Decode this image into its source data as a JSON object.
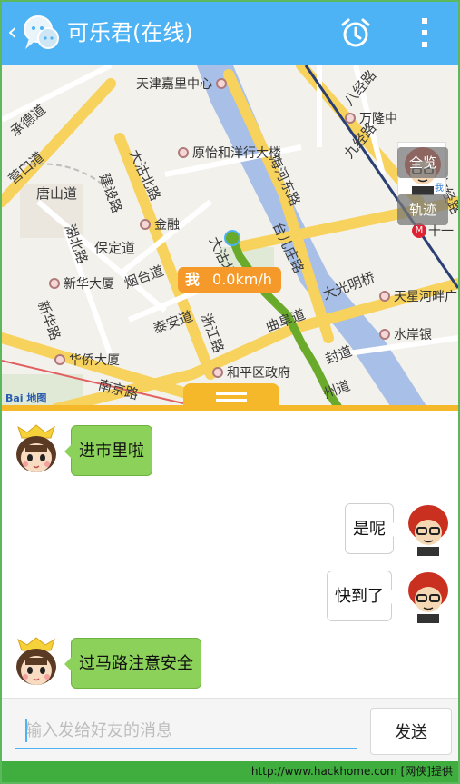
{
  "header": {
    "title": "可乐君(在线)",
    "back_glyph": "‹"
  },
  "map": {
    "speed_tag": {
      "me": "我",
      "speed": "0.0km/h"
    },
    "buttons": {
      "overview": "全览",
      "track": "轨迹"
    },
    "avatar_tag": "我",
    "baidu_logo": "Bai 地图",
    "places": [
      "天津嘉里中心",
      "万隆中",
      "原怡和洋行大楼",
      "金融",
      "新华大厦",
      "华侨大厦",
      "和平区政府",
      "天星河畔广",
      "水岸银",
      "十一"
    ],
    "roads": [
      "承德道",
      "营口道",
      "唐山道",
      "建设路",
      "保定道",
      "湖北路",
      "烟台道",
      "新华路",
      "泰安道",
      "浙江路",
      "南京路",
      "大沽北路",
      "海河东路",
      "台儿庄路",
      "大光明桥",
      "曲阜道",
      "八经路",
      "九经路",
      "七经路",
      "封道",
      "州道",
      "大沽北路"
    ]
  },
  "chat": {
    "messages": [
      {
        "side": "left",
        "text": "进市里啦"
      },
      {
        "side": "right",
        "text": "是呢"
      },
      {
        "side": "right",
        "text": "快到了"
      },
      {
        "side": "left",
        "text": "过马路注意安全"
      }
    ]
  },
  "input": {
    "placeholder": "输入发给好友的消息",
    "send_label": "发送"
  },
  "watermark": "http://www.hackhome.com [网侠]提供",
  "colors": {
    "header": "#4db3f5",
    "accent_orange": "#f59a2a",
    "handle_yellow": "#f5b82a",
    "bubble_green": "#8cd15a",
    "track_green": "#6aaa2a"
  }
}
